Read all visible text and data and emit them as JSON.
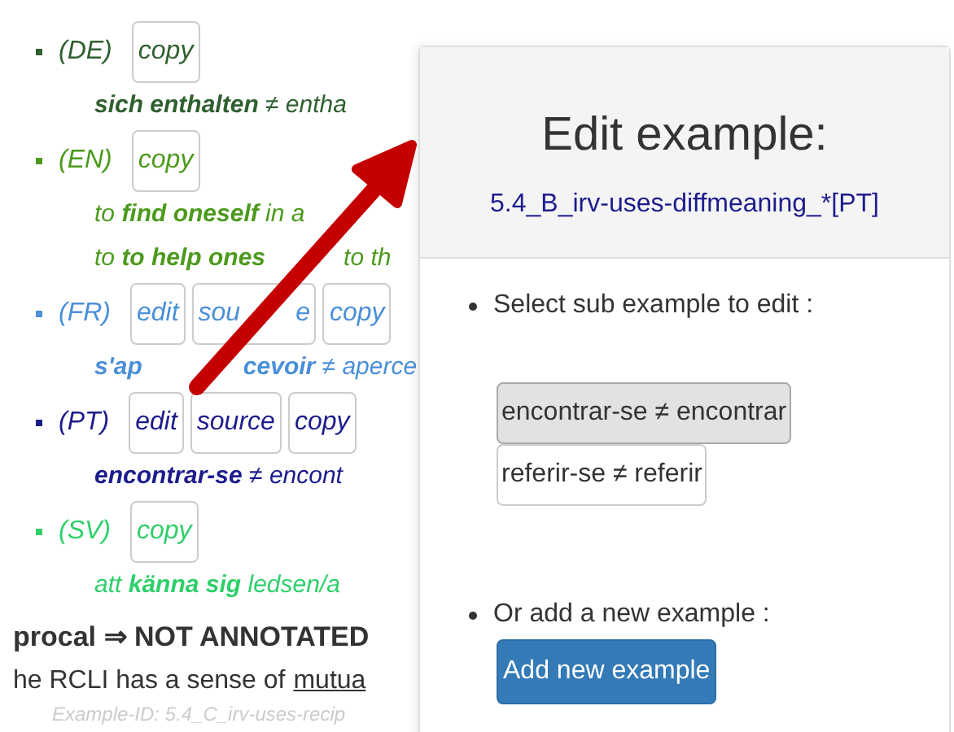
{
  "examples": [
    {
      "lang": "(DE)",
      "color": "#2f5f2f",
      "buttons": [
        {
          "parts": [
            "copy"
          ]
        }
      ],
      "lines": [
        {
          "parts": [
            "**sich enthalten** ≠ entha"
          ]
        }
      ]
    },
    {
      "lang": "(EN)",
      "color": "#4c9a1c",
      "buttons": [
        {
          "parts": [
            "copy"
          ]
        }
      ],
      "lines": [
        {
          "parts": [
            "to **find oneself** in a"
          ]
        },
        {
          "parts": [
            "to **to help ones**",
            "to th"
          ]
        }
      ]
    },
    {
      "lang": "(FR)",
      "color": "#4a8fd8",
      "buttons": [
        {
          "parts": [
            "edit"
          ]
        },
        {
          "parts": [
            "sou",
            "e"
          ]
        },
        {
          "parts": [
            "copy"
          ]
        }
      ],
      "lines": [
        {
          "parts": [
            "**s'ap**",
            "**cevoir** ≠ aperce"
          ]
        }
      ]
    },
    {
      "lang": "(PT)",
      "color": "#1c1c8c",
      "buttons": [
        {
          "parts": [
            "edit"
          ]
        },
        {
          "parts": [
            "source"
          ]
        },
        {
          "parts": [
            "copy"
          ]
        }
      ],
      "lines": [
        {
          "parts": [
            "**encontrar-se** ≠ encont"
          ]
        }
      ]
    },
    {
      "lang": "(SV)",
      "color": "#2fcf6a",
      "buttons": [
        {
          "parts": [
            "copy"
          ]
        }
      ],
      "lines": [
        {
          "parts": [
            "att **känna sig** ledsen/a"
          ]
        }
      ]
    }
  ],
  "heading_line": "**procal** ⇒ **NOT ANNOTATED**",
  "sentence": {
    "text": "he RCLI has a sense of",
    "link": "mutua"
  },
  "example_id": "Example-ID: 5.4_C_irv-uses-recip",
  "dialog": {
    "title": "Edit example:",
    "subtitle": "5.4_B_irv-uses-diffmeaning_*[PT]",
    "select_label": "Select sub example to edit :",
    "sub_examples": [
      {
        "label": "encontrar-se ≠ encontrar",
        "selected": true
      },
      {
        "label": "referir-se ≠ referir",
        "selected": false
      }
    ],
    "add_label": "Or add a new example :",
    "add_button": "Add new example"
  }
}
